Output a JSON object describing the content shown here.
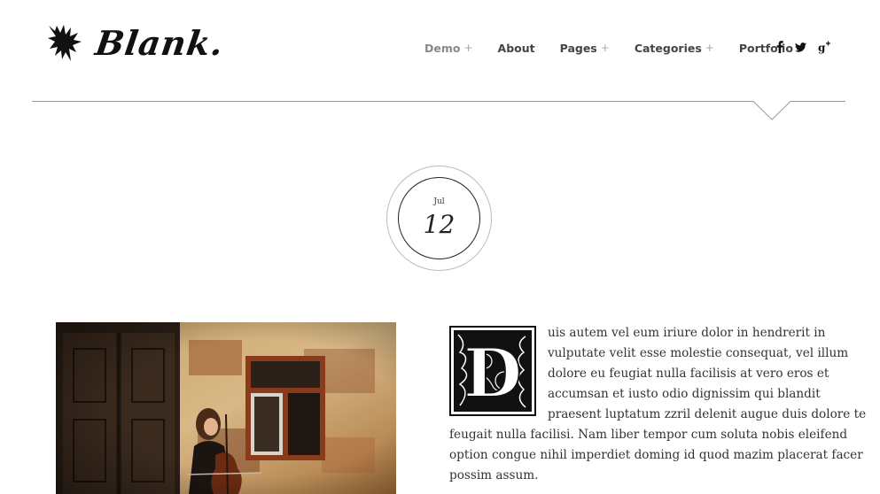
{
  "brand": {
    "name": "Blank.",
    "logo_icon": "eagle-icon"
  },
  "nav": [
    {
      "label": "Demo",
      "has_submenu": true,
      "active": true
    },
    {
      "label": "About",
      "has_submenu": false,
      "active": false
    },
    {
      "label": "Pages",
      "has_submenu": true,
      "active": false
    },
    {
      "label": "Categories",
      "has_submenu": true,
      "active": false
    },
    {
      "label": "Portfolio",
      "has_submenu": true,
      "active": false
    }
  ],
  "nav_plus": "+",
  "social": [
    {
      "icon": "facebook-icon"
    },
    {
      "icon": "twitter-icon"
    },
    {
      "icon": "google-plus-icon"
    }
  ],
  "post": {
    "date": {
      "month": "Jul",
      "day": "12"
    },
    "dropcap_letter": "D",
    "body_lines": [
      "uis autem vel eum iriure dolor in hendrerit in",
      "vulputate velit esse molestie consequat, vel illum",
      "dolore eu feugiat nulla facilisis at vero eros et",
      "accumsan et iusto odio dignissim qui blandit",
      "praesent luptatum zzril delenit augue duis dolore te",
      "feugait nulla facilisi. Nam liber tempor cum soluta nobis eleifend",
      "option congue nihil imperdiet doming id quod mazim placerat facer",
      "possim assum."
    ]
  },
  "colors": {
    "accent_text": "#444444",
    "active_nav": "#888888",
    "divider": "#999999",
    "background": "#ffffff"
  }
}
